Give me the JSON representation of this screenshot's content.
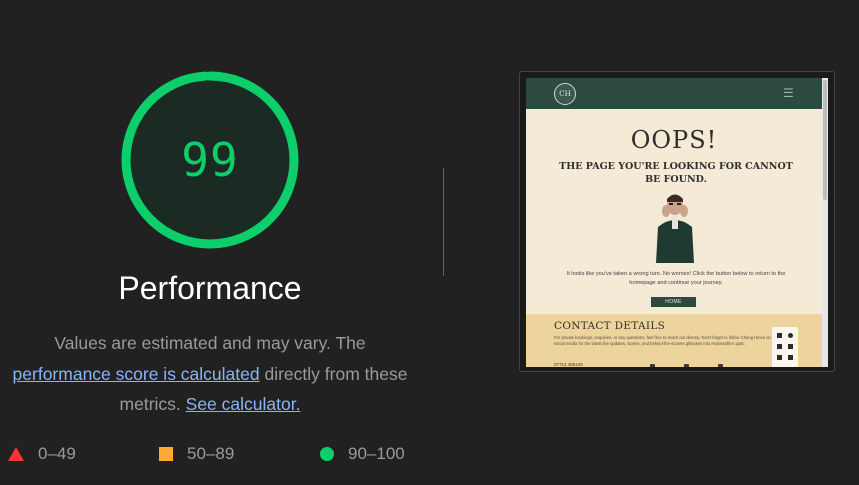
{
  "gauge": {
    "score": "99",
    "fraction": 0.99,
    "color": "#0cce6b"
  },
  "category": {
    "title": "Performance"
  },
  "description": {
    "text_before": "Values are estimated and may vary. The",
    "link1": "performance score is calculated",
    "text_middle": "directly from these metrics.",
    "link2": "See calculator."
  },
  "legend": [
    {
      "range": "0–49",
      "icon": "triangle-icon",
      "color": "#ff3333"
    },
    {
      "range": "50–89",
      "icon": "square-icon",
      "color": "#ffaa33"
    },
    {
      "range": "90–100",
      "icon": "circle-icon",
      "color": "#0cce6b"
    }
  ],
  "screenshot": {
    "logo_text": "CH",
    "menu_icon": "hamburger-icon",
    "heading": "OOPS!",
    "subheading": "THE PAGE YOU'RE LOOKING FOR CANNOT BE FOUND.",
    "lead": "It looks like you've taken a wrong turn. No worries! Click the button below to return to the homepage and continue your journey.",
    "button": "HOME",
    "contact_title": "CONTACT DETAILS",
    "contact_text": "For private bookings, enquiries, or any questions, feel free to reach out directly. Don't forget to follow Chang Hines on social media for the latest live updates, stories, and behind-the-scenes glimpses into Hainesville's past.",
    "contact_phone": "07713 485105"
  }
}
